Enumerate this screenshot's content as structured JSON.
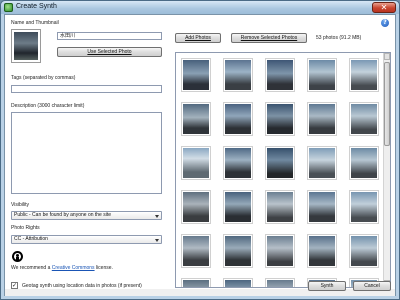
{
  "window": {
    "title": "Create Synth",
    "close_glyph": "✕"
  },
  "help_glyph": "?",
  "name_section": {
    "label": "Name and Thumbnail",
    "name_value": "水田川",
    "use_selected_label": "Use Selected Photo"
  },
  "tags": {
    "label": "Tags (separated by commas)",
    "value": ""
  },
  "description": {
    "label": "Description (3000 character limit)",
    "value": ""
  },
  "visibility": {
    "label": "Visibility",
    "selected": "Public - Can be found by anyone on the site"
  },
  "rights": {
    "label": "Photo Rights",
    "selected": "CC - Attribution"
  },
  "recommend": {
    "prefix": "We recommend a ",
    "link": "Creative Commons",
    "suffix": " license."
  },
  "photos_toolbar": {
    "add_label": "Add Photos",
    "remove_label": "Remove Selected Photos",
    "count_text": "53 photos (91.2 MB)"
  },
  "footer": {
    "geotag_label": "Geotag synth using location data in photos (if present)",
    "geotag_checked": true,
    "synth_label": "Synth",
    "cancel_label": "Cancel"
  },
  "colors": {
    "accent": "#1a55b5",
    "title_bar": "#a9c6df"
  }
}
